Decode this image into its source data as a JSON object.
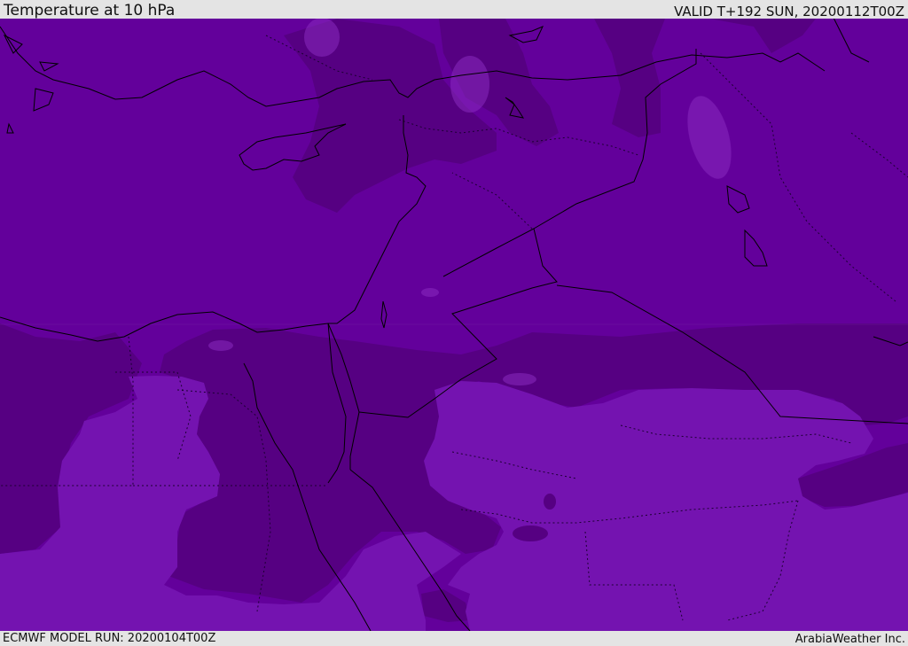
{
  "header": {
    "title": "Temperature at 10 hPa",
    "valid": "VALID T+192 SUN, 20200112T00Z"
  },
  "footer": {
    "model_run": "ECMWF MODEL RUN: 20200104T00Z",
    "credit": "ArabiaWeather Inc."
  },
  "map": {
    "region": "Eastern Mediterranean and Middle East",
    "colors": {
      "base": "#63009b",
      "dark": "#560082",
      "light": "#7413b0",
      "lighter": "#8a2bc0",
      "coast": "#000000",
      "border": "#1c0032"
    }
  }
}
